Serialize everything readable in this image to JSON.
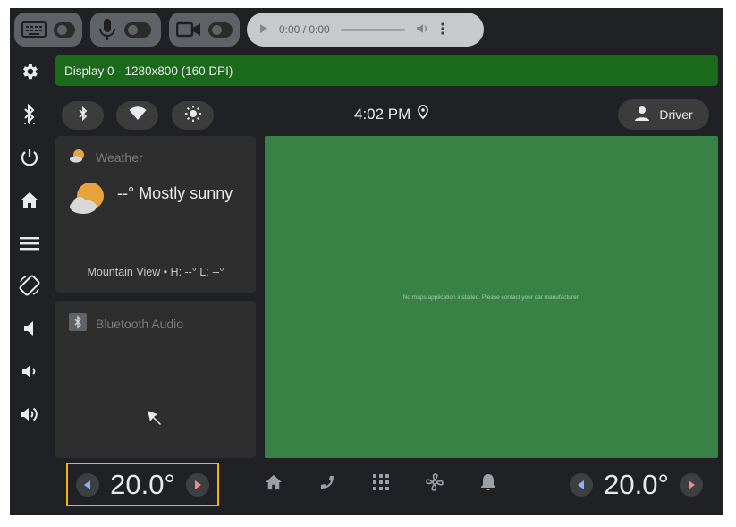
{
  "media": {
    "time": "0:00 / 0:00"
  },
  "banner": {
    "text": "Display 0 - 1280x800 (160 DPI)"
  },
  "status": {
    "time": "4:02 PM",
    "user": "Driver"
  },
  "weather": {
    "title": "Weather",
    "condition": "--° Mostly sunny",
    "location": "Mountain View • H: --° L: --°"
  },
  "bluetooth_audio": {
    "title": "Bluetooth Audio"
  },
  "map": {
    "message": "No maps application installed. Please contact your car manufacturer."
  },
  "hvac": {
    "left_temp": "20.0°",
    "right_temp": "20.0°"
  },
  "colors": {
    "background": "#202124",
    "banner": "#1b6a1b",
    "map_panel": "#388245",
    "highlight": "#f4b400",
    "arrow_accent": "#f28b82"
  }
}
